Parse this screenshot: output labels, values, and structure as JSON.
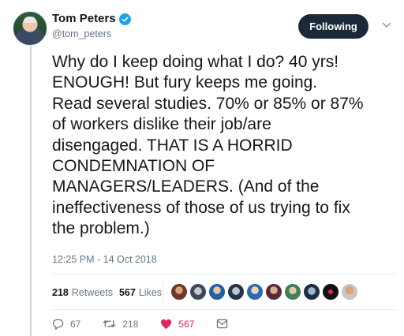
{
  "author": {
    "display_name": "Tom Peters",
    "handle": "@tom_peters",
    "follow_label": "Following"
  },
  "tweet": {
    "text": "Why do I keep doing what I do? 40 yrs!\nENOUGH! But  fury keeps me going.\nRead several studies. 70% or 85% or 87%\nof workers dislike their job/are\ndisengaged. THAT IS A HORRID\nCONDEMNATION OF\nMANAGERS/LEADERS. (And of the\nineffectiveness of those of us trying to fix\nthe problem.)",
    "timestamp": "12:25 PM - 14 Oct 2018"
  },
  "stats": {
    "retweets_count": "218",
    "retweets_label": "Retweets",
    "likes_count": "567",
    "likes_label": "Likes"
  },
  "actions": {
    "reply_count": "67",
    "retweet_count": "218",
    "like_count": "567"
  },
  "colors": {
    "verified": "#1da1f2",
    "like": "#e0245e",
    "follow_button": "#1c2938"
  },
  "liker_avatars": [
    "liker-1",
    "liker-2",
    "liker-3",
    "liker-4",
    "liker-5",
    "liker-6",
    "liker-7",
    "liker-8",
    "liker-9",
    "liker-10"
  ]
}
